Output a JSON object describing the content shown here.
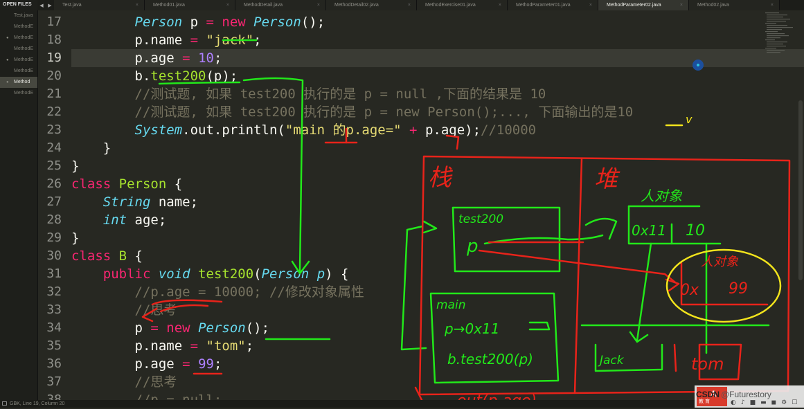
{
  "sidebar": {
    "header": "OPEN FILES",
    "files": [
      {
        "label": "Test.java",
        "dot": false,
        "active": false
      },
      {
        "label": "MethodE",
        "dot": false,
        "active": false
      },
      {
        "label": "MethodE",
        "dot": true,
        "active": false
      },
      {
        "label": "MethodE",
        "dot": false,
        "active": false
      },
      {
        "label": "MethodE",
        "dot": true,
        "active": false
      },
      {
        "label": "MethodE",
        "dot": false,
        "active": false
      },
      {
        "label": "Method",
        "dot": true,
        "active": true
      },
      {
        "label": "MethodE",
        "dot": false,
        "active": false
      }
    ]
  },
  "tabs": {
    "nav_left": "◀",
    "nav_right": "▶",
    "close": "×",
    "items": [
      {
        "label": "Test.java",
        "active": false
      },
      {
        "label": "Method01.java",
        "active": false
      },
      {
        "label": "MethodDetail.java",
        "active": false
      },
      {
        "label": "MethodDetail02.java",
        "active": false
      },
      {
        "label": "MethodExercise01.java",
        "active": false
      },
      {
        "label": "MethodParameter01.java",
        "active": false
      },
      {
        "label": "MethodParameter02.java",
        "active": true
      },
      {
        "label": "Method02.java",
        "active": false
      }
    ]
  },
  "editor": {
    "current_line": 19,
    "lines": [
      {
        "n": "17",
        "tokens": [
          [
            "",
            "        "
          ],
          [
            "ty",
            "Person"
          ],
          [
            "",
            " p "
          ],
          [
            "kw",
            "="
          ],
          [
            "",
            " "
          ],
          [
            "kw",
            "new"
          ],
          [
            "",
            " "
          ],
          [
            "ty",
            "Person"
          ],
          [
            "",
            "();"
          ]
        ]
      },
      {
        "n": "18",
        "tokens": [
          [
            "",
            "        p."
          ],
          [
            "",
            "name "
          ],
          [
            "kw",
            "="
          ],
          [
            "",
            " "
          ],
          [
            "str",
            "\"jack\""
          ],
          [
            "",
            ";"
          ]
        ]
      },
      {
        "n": "19",
        "tokens": [
          [
            "",
            "        p.age "
          ],
          [
            "kw",
            "="
          ],
          [
            "",
            " "
          ],
          [
            "num",
            "10"
          ],
          [
            "",
            ";"
          ]
        ]
      },
      {
        "n": "20",
        "tokens": [
          [
            "",
            "        b."
          ],
          [
            "fn",
            "test200"
          ],
          [
            "",
            "(p);"
          ]
        ]
      },
      {
        "n": "21",
        "tokens": [
          [
            "cm",
            "        //测试题, 如果 test200 执行的是 p = null ,下面的结果是 10"
          ]
        ]
      },
      {
        "n": "22",
        "tokens": [
          [
            "cm",
            "        //测试题, 如果 test200 执行的是 p = new Person();..., 下面输出的是10"
          ]
        ]
      },
      {
        "n": "23",
        "tokens": [
          [
            "",
            "        "
          ],
          [
            "ty",
            "System"
          ],
          [
            "",
            ".out.println("
          ],
          [
            "str",
            "\"main 的p.age=\""
          ],
          [
            "",
            " "
          ],
          [
            "kw",
            "+"
          ],
          [
            "",
            " p.age);"
          ],
          [
            "cm",
            "//10000"
          ]
        ]
      },
      {
        "n": "24",
        "tokens": [
          [
            "",
            "    }"
          ]
        ]
      },
      {
        "n": "25",
        "tokens": [
          [
            "",
            "}"
          ]
        ]
      },
      {
        "n": "26",
        "tokens": [
          [
            "kw",
            "class"
          ],
          [
            "",
            " "
          ],
          [
            "cls",
            "Person"
          ],
          [
            "",
            " {"
          ]
        ]
      },
      {
        "n": "27",
        "tokens": [
          [
            "",
            "    "
          ],
          [
            "ty",
            "String"
          ],
          [
            "",
            " name;"
          ]
        ]
      },
      {
        "n": "28",
        "tokens": [
          [
            "",
            "    "
          ],
          [
            "ty",
            "int"
          ],
          [
            "",
            " age;"
          ]
        ]
      },
      {
        "n": "29",
        "tokens": [
          [
            "",
            "}"
          ]
        ]
      },
      {
        "n": "30",
        "tokens": [
          [
            "kw",
            "class"
          ],
          [
            "",
            " "
          ],
          [
            "cls",
            "B"
          ],
          [
            "",
            " {"
          ]
        ]
      },
      {
        "n": "31",
        "tokens": [
          [
            "",
            "    "
          ],
          [
            "kw",
            "public"
          ],
          [
            "",
            " "
          ],
          [
            "ty",
            "void"
          ],
          [
            "",
            " "
          ],
          [
            "fn",
            "test200"
          ],
          [
            "",
            "("
          ],
          [
            "ty",
            "Person"
          ],
          [
            "",
            " "
          ],
          [
            "ty",
            "p"
          ],
          [
            "",
            ") {"
          ]
        ]
      },
      {
        "n": "32",
        "tokens": [
          [
            "cm",
            "        //p.age = 10000; //修改对象属性"
          ]
        ]
      },
      {
        "n": "33",
        "tokens": [
          [
            "cm",
            "        //思考"
          ]
        ]
      },
      {
        "n": "34",
        "tokens": [
          [
            "",
            "        p "
          ],
          [
            "kw",
            "="
          ],
          [
            "",
            " "
          ],
          [
            "kw",
            "new"
          ],
          [
            "",
            " "
          ],
          [
            "ty",
            "Person"
          ],
          [
            "",
            "();"
          ]
        ]
      },
      {
        "n": "35",
        "tokens": [
          [
            "",
            "        p.name "
          ],
          [
            "kw",
            "="
          ],
          [
            "",
            " "
          ],
          [
            "str",
            "\"tom\""
          ],
          [
            "",
            ";"
          ]
        ]
      },
      {
        "n": "36",
        "tokens": [
          [
            "",
            "        p.age "
          ],
          [
            "kw",
            "="
          ],
          [
            "",
            " "
          ],
          [
            "num",
            "99"
          ],
          [
            "",
            ";"
          ]
        ]
      },
      {
        "n": "37",
        "tokens": [
          [
            "cm",
            "        //思考"
          ]
        ]
      },
      {
        "n": "38",
        "tokens": [
          [
            "cm",
            "        //p = null;"
          ]
        ]
      }
    ]
  },
  "handwriting": {
    "stack_label": "栈",
    "heap_label": "堆",
    "object_label": "人对象",
    "object2_label": "人对象",
    "frame_test200": "test200",
    "frame_p": "p",
    "frame_main": "main",
    "main_p": "p→0x11",
    "main_call": "b.test200(p)",
    "obj_addr": "0x11",
    "obj_age": "10",
    "obj2_addr": "0x",
    "obj2_age": "99",
    "jack": "Jack",
    "tom": "tom",
    "bottom_text": "out(p.age)",
    "check": "v",
    "colors": {
      "red": "#e8231a",
      "green": "#22e81a",
      "yellow": "#f2e41c"
    }
  },
  "status": {
    "text": "GBK, Line 19, Column 20"
  },
  "watermark": {
    "site": "CSDN",
    "user": "@Futurestory",
    "badge_text": "A",
    "badge_sub": "教 育",
    "controls": [
      "◐",
      "♪",
      "■",
      "▬",
      "◼",
      "⚙",
      "☐"
    ]
  }
}
